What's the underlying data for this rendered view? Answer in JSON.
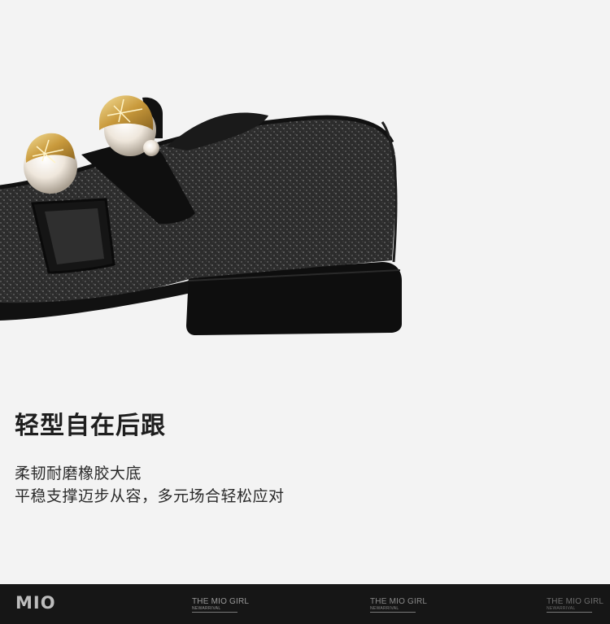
{
  "headline": "轻型自在后跟",
  "description": {
    "line1": "柔韧耐磨橡胶大底",
    "line2": "平稳支撑迈步从容，多元场合轻松应对"
  },
  "footer": {
    "logo": "MIO",
    "watermarks": [
      {
        "title": "THE MIO GIRL",
        "subtitle": "NEWARRIVAL"
      },
      {
        "title": "THE MIO GIRL",
        "subtitle": "NEWARRIVAL"
      },
      {
        "title": "THE MIO GIRL",
        "subtitle": "NEWARRIVAL"
      }
    ]
  },
  "colors": {
    "background": "#f3f3f3",
    "footer": "#161616",
    "shoe_body": "#2b2b2b",
    "heel": "#0d0d0d",
    "pearl": "#efe7dc",
    "gold": "#d2a64a"
  }
}
